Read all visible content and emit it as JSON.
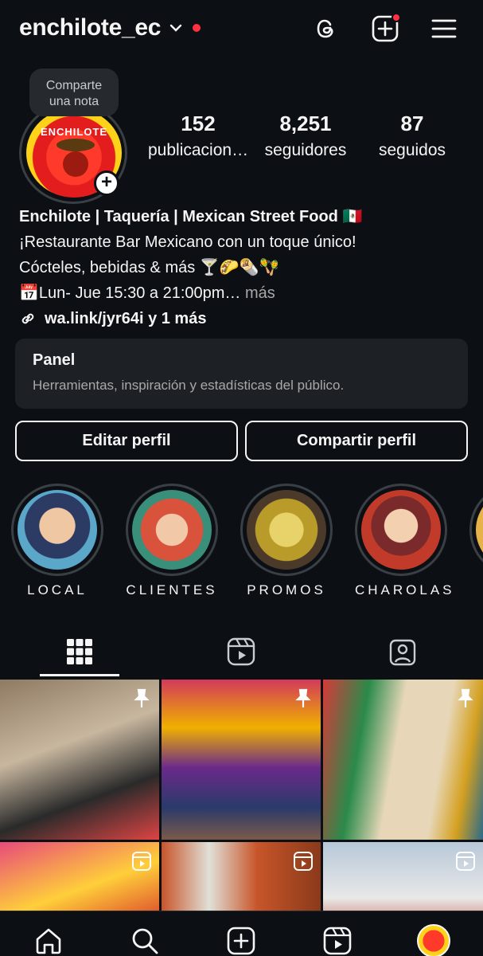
{
  "header": {
    "username": "enchilote_ec"
  },
  "note": {
    "text_line1": "Comparte",
    "text_line2": "una nota"
  },
  "avatar": {
    "logo_text": "ENCHILOTE"
  },
  "stats": [
    {
      "num": "152",
      "label": "publicacion…"
    },
    {
      "num": "8,251",
      "label": "seguidores"
    },
    {
      "num": "87",
      "label": "seguidos"
    }
  ],
  "bio": {
    "name": "Enchilote | Taquería | Mexican Street Food 🇲🇽",
    "line1": "¡Restaurante Bar Mexicano con un toque único!",
    "line2": "Cócteles, bebidas & más 🍸🌮🌯🪇",
    "line3": "📅Lun- Jue 15:30 a 21:00pm…",
    "more": " más",
    "link": "wa.link/jyr64i y 1 más"
  },
  "panel": {
    "title": "Panel",
    "subtitle": "Herramientas, inspiración y estadísticas del público."
  },
  "buttons": {
    "edit": "Editar perfil",
    "share": "Compartir perfil"
  },
  "highlights": [
    {
      "label": "LOCAL"
    },
    {
      "label": "CLIENTES"
    },
    {
      "label": "PROMOS"
    },
    {
      "label": "CHAROLAS"
    }
  ],
  "colors": {
    "background": "#0c1014",
    "notification": "#ff3040",
    "panel": "#1d2126"
  }
}
